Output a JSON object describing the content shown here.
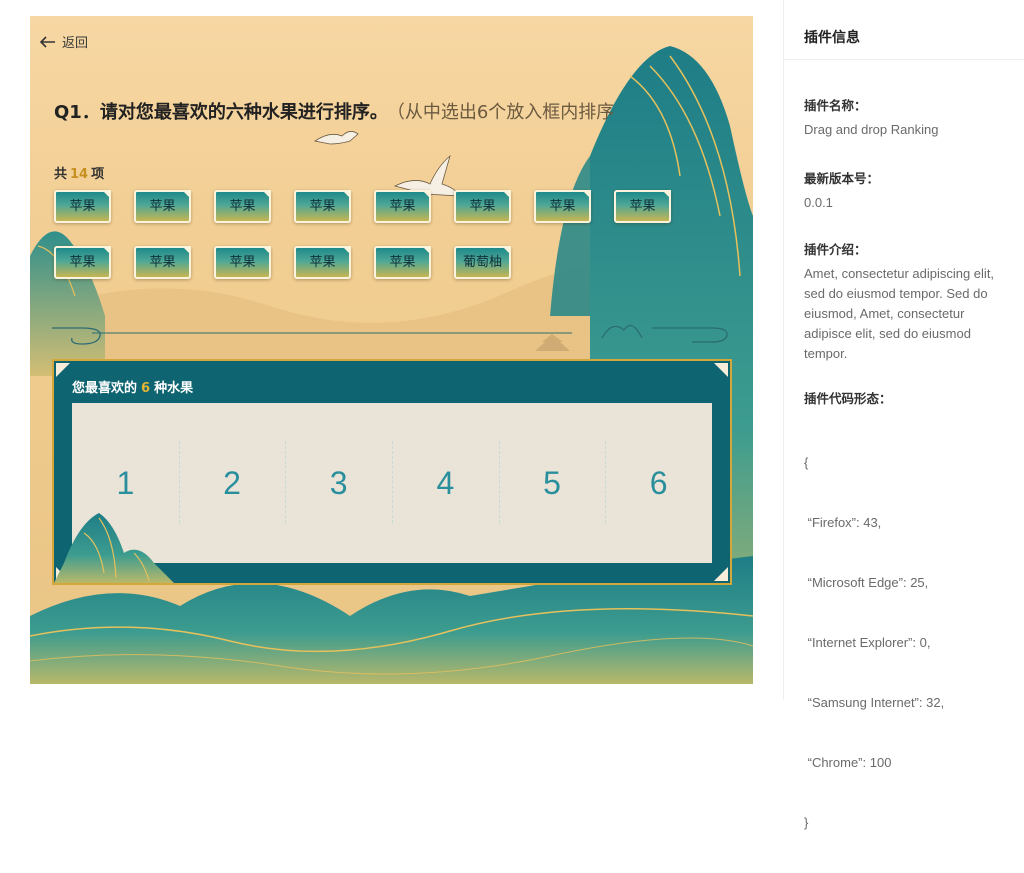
{
  "stage": {
    "back_label": "返回",
    "question_number": "Q1．",
    "question_text": "请对您最喜欢的六种水果进行排序。",
    "question_hint": "（从中选出6个放入框内排序",
    "count_prefix": "共",
    "count_value": "14",
    "count_suffix": "项",
    "items": [
      "苹果",
      "苹果",
      "苹果",
      "苹果",
      "苹果",
      "苹果",
      "苹果",
      "苹果",
      "苹果",
      "苹果",
      "苹果",
      "苹果",
      "苹果",
      "葡萄柚"
    ],
    "dropbox_prefix": "您最喜欢的",
    "dropbox_number": "6",
    "dropbox_suffix": "种水果",
    "slots": [
      "1",
      "2",
      "3",
      "4",
      "5",
      "6"
    ]
  },
  "panel": {
    "header": "插件信息",
    "name_label": "插件名称：",
    "name_value": "Drag and drop Ranking",
    "version_label": "最新版本号：",
    "version_value": "0.0.1",
    "intro_label": "插件介绍：",
    "intro_value": "Amet, consectetur adipiscing elit, sed do eiusmod tempor. Sed do eiusmod, Amet, consectetur adipisce elit, sed do eiusmod tempor.",
    "code_label": "插件代码形态：",
    "code_lines": [
      "{",
      " “Firefox”: 43,",
      " “Microsoft Edge”: 25,",
      " “Internet Explorer”: 0,",
      " “Samsung Internet”: 32,",
      " “Chrome”: 100",
      "}"
    ]
  },
  "colors": {
    "accent_gold": "#c78f1e",
    "box_teal": "#0e6470",
    "slot_number": "#2a8f9c"
  }
}
